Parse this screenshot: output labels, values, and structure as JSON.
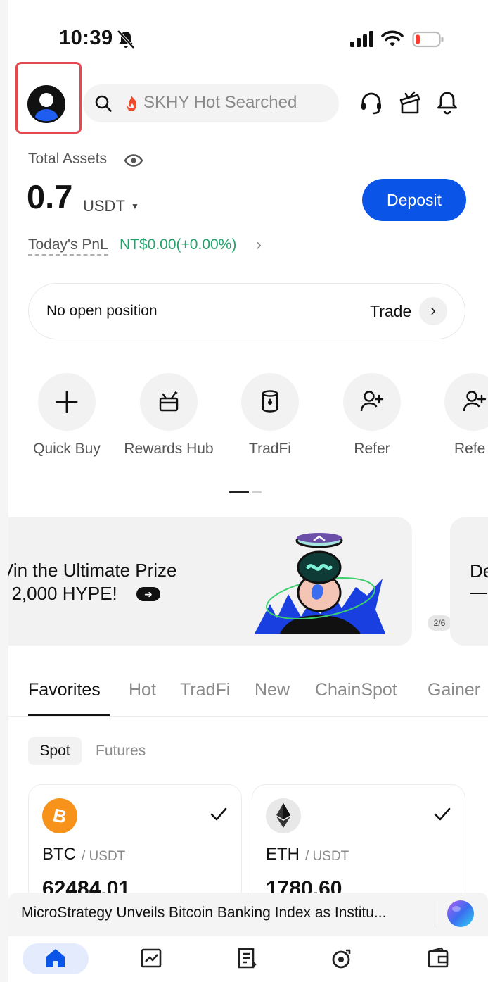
{
  "status_bar": {
    "time": "10:39"
  },
  "header": {
    "search_placeholder": "SKHY Hot Searched",
    "icons": [
      "support-headset-icon",
      "gift-box-icon",
      "bell-icon"
    ]
  },
  "assets": {
    "label": "Total Assets",
    "value": "0.7",
    "unit": "USDT",
    "deposit_label": "Deposit",
    "pnl_label": "Today's PnL",
    "pnl_value": "NT$0.00(+0.00%)"
  },
  "position": {
    "text": "No open position",
    "trade_label": "Trade"
  },
  "quick_actions": [
    {
      "label": "Quick Buy",
      "icon": "plus-icon"
    },
    {
      "label": "Rewards Hub",
      "icon": "gift-icon"
    },
    {
      "label": "TradFi",
      "icon": "barrel-icon"
    },
    {
      "label": "Refer",
      "icon": "add-user-icon"
    },
    {
      "label": "Refe",
      "icon": "add-user-icon"
    }
  ],
  "banner": {
    "line1": "Vin the Ultimate Prize",
    "line2": "f 2,000 HYPE!",
    "page": "2/6",
    "next_peek": "De"
  },
  "market_tabs": [
    "Favorites",
    "Hot",
    "TradFi",
    "New",
    "ChainSpot",
    "Gainer"
  ],
  "sub_tabs": [
    "Spot",
    "Futures"
  ],
  "coins": [
    {
      "name": "BTC",
      "quote": "/ USDT",
      "price": "62484.01",
      "icon": "bitcoin-icon",
      "color": "#f7931a"
    },
    {
      "name": "ETH",
      "quote": "/ USDT",
      "price": "1780.60",
      "icon": "ethereum-icon",
      "color": "#e8e8e8"
    }
  ],
  "news": {
    "headline": "MicroStrategy Unveils Bitcoin Banking Index as Institu..."
  },
  "bottom_nav": [
    "home-icon",
    "markets-icon",
    "trade-icon",
    "earn-icon",
    "wallet-icon"
  ],
  "colors": {
    "accent": "#0a55e8",
    "positive": "#23a36b",
    "highlight": "#e5484d"
  }
}
